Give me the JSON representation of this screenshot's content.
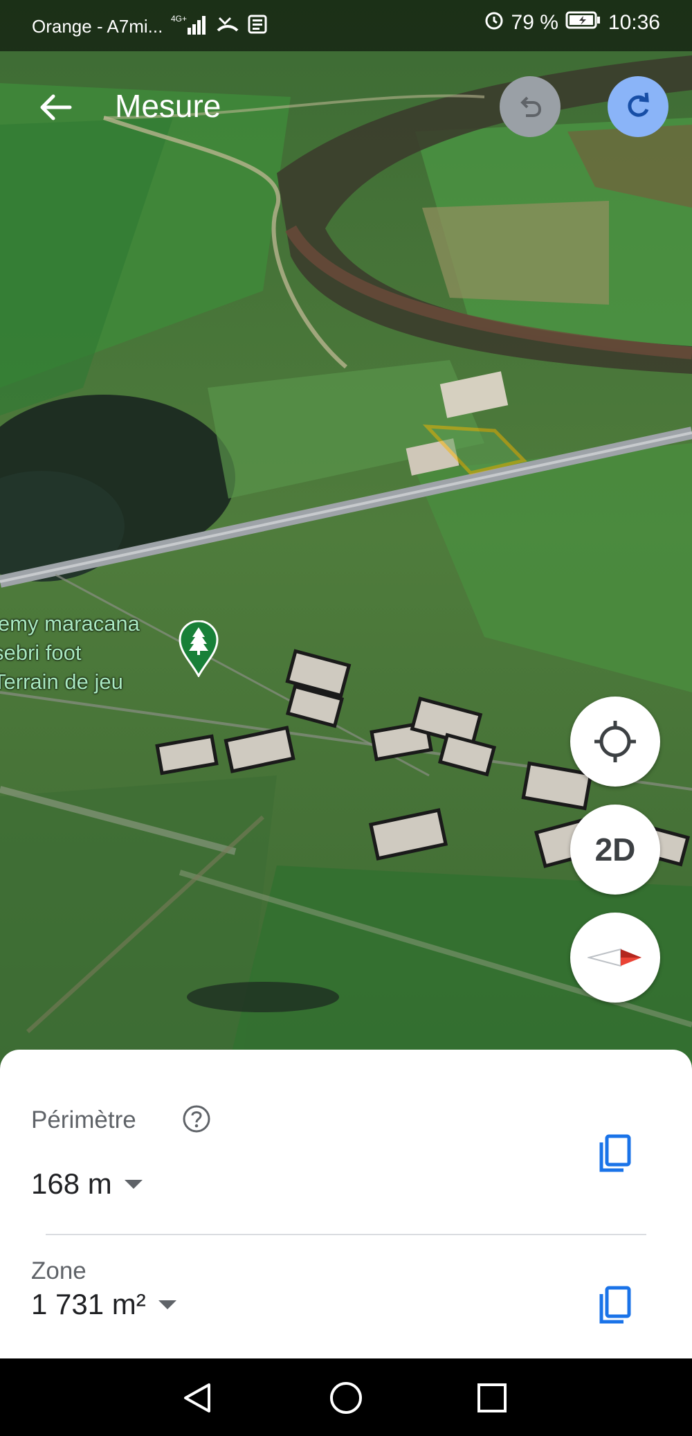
{
  "status_bar": {
    "carrier": "Orange - A7mi...",
    "network": "4G+",
    "battery": "79 %",
    "time": "10:36"
  },
  "header": {
    "title": "Mesure",
    "back_icon": "arrow-back-icon",
    "undo_icon": "undo-icon",
    "redo_icon": "redo-icon"
  },
  "map": {
    "place_name_line1": "lemy maracana",
    "place_name_line2": "sebri foot",
    "place_category": "Terrain de jeu",
    "pin_icon": "park-pin-icon",
    "measured_area_color": "#f5b400",
    "road_color": "#9ea3a8"
  },
  "controls": {
    "locate_icon": "my-location-icon",
    "view_mode_label": "2D",
    "compass_icon": "compass-icon"
  },
  "measurement": {
    "perimeter_label": "Périmètre",
    "perimeter_value": "168 m",
    "area_label": "Zone",
    "area_value": "1 731 m²",
    "help_icon": "help-icon",
    "copy_icon": "copy-icon",
    "accent_color": "#1a73e8"
  },
  "nav_bar": {
    "back_icon": "nav-back-icon",
    "home_icon": "nav-home-icon",
    "recents_icon": "nav-recents-icon"
  }
}
